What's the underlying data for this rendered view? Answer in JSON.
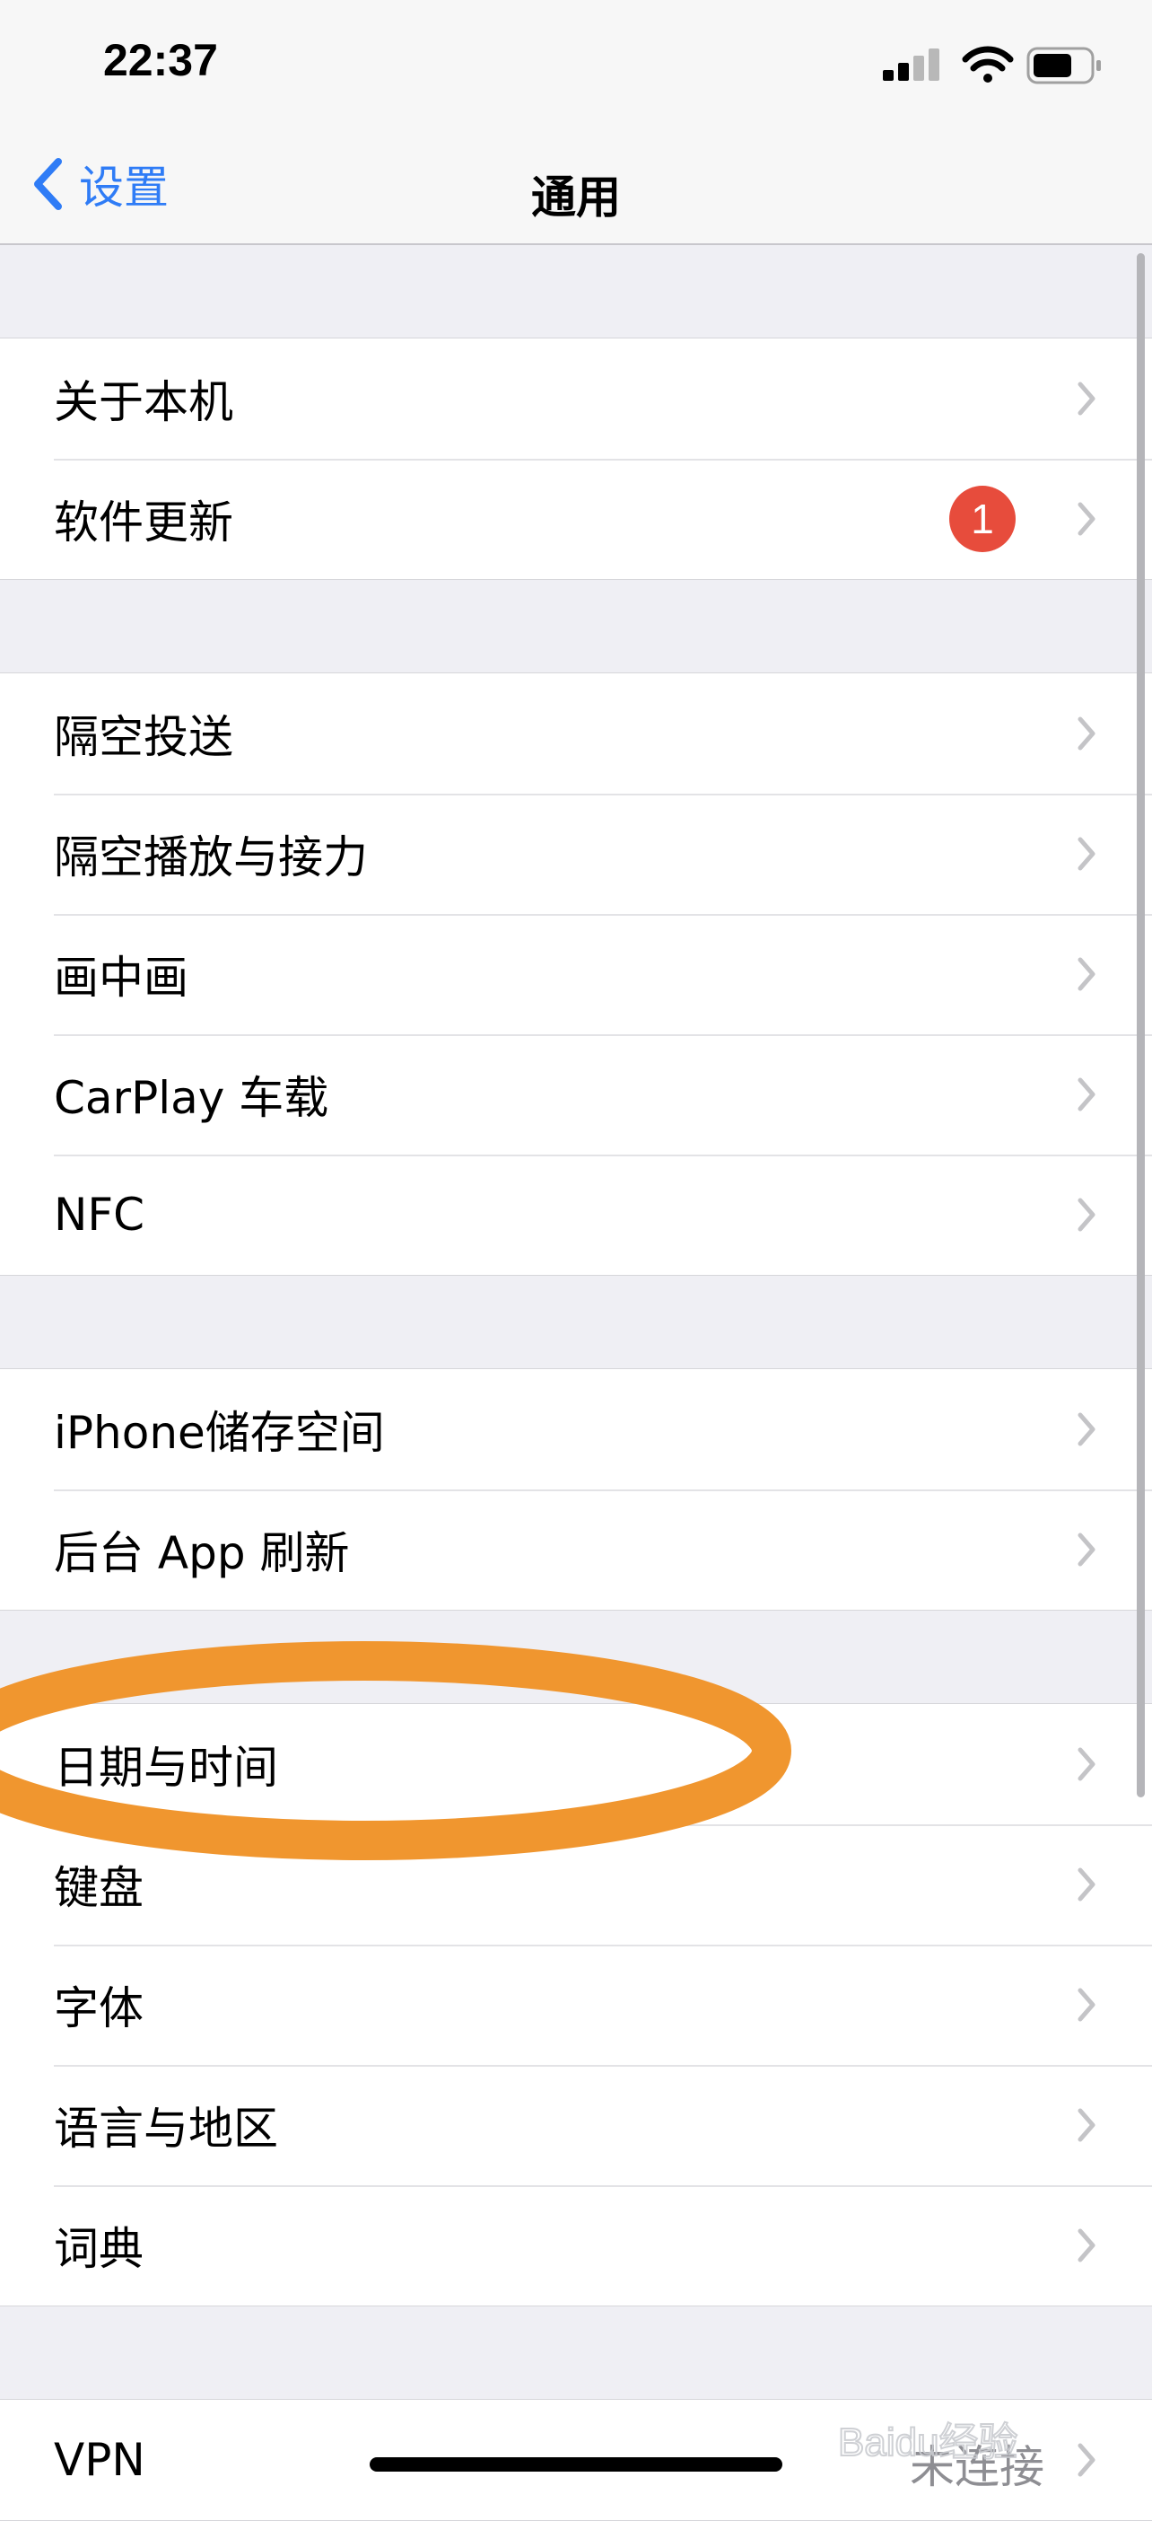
{
  "status_bar": {
    "time": "22:37"
  },
  "nav": {
    "back_label": "设置",
    "title": "通用"
  },
  "groups": [
    [
      {
        "label": "关于本机"
      },
      {
        "label": "软件更新",
        "badge": "1"
      }
    ],
    [
      {
        "label": "隔空投送"
      },
      {
        "label": "隔空播放与接力"
      },
      {
        "label": "画中画"
      },
      {
        "label": "CarPlay 车载"
      },
      {
        "label": "NFC"
      }
    ],
    [
      {
        "label": "iPhone储存空间"
      },
      {
        "label": "后台 App 刷新"
      }
    ],
    [
      {
        "label": "日期与时间"
      },
      {
        "label": "键盘"
      },
      {
        "label": "字体"
      },
      {
        "label": "语言与地区"
      },
      {
        "label": "词典"
      }
    ],
    [
      {
        "label": "VPN",
        "value": "未连接"
      }
    ]
  ],
  "watermark": {
    "text": "Baidu经验"
  },
  "colors": {
    "accent": "#2f7cf6",
    "badge": "#e74c3c",
    "annotation": "#f0962f",
    "background": "#efeff4"
  },
  "icons": [
    "chevron-left-icon",
    "signal-icon",
    "wifi-icon",
    "battery-icon",
    "chevron-right-icon"
  ]
}
